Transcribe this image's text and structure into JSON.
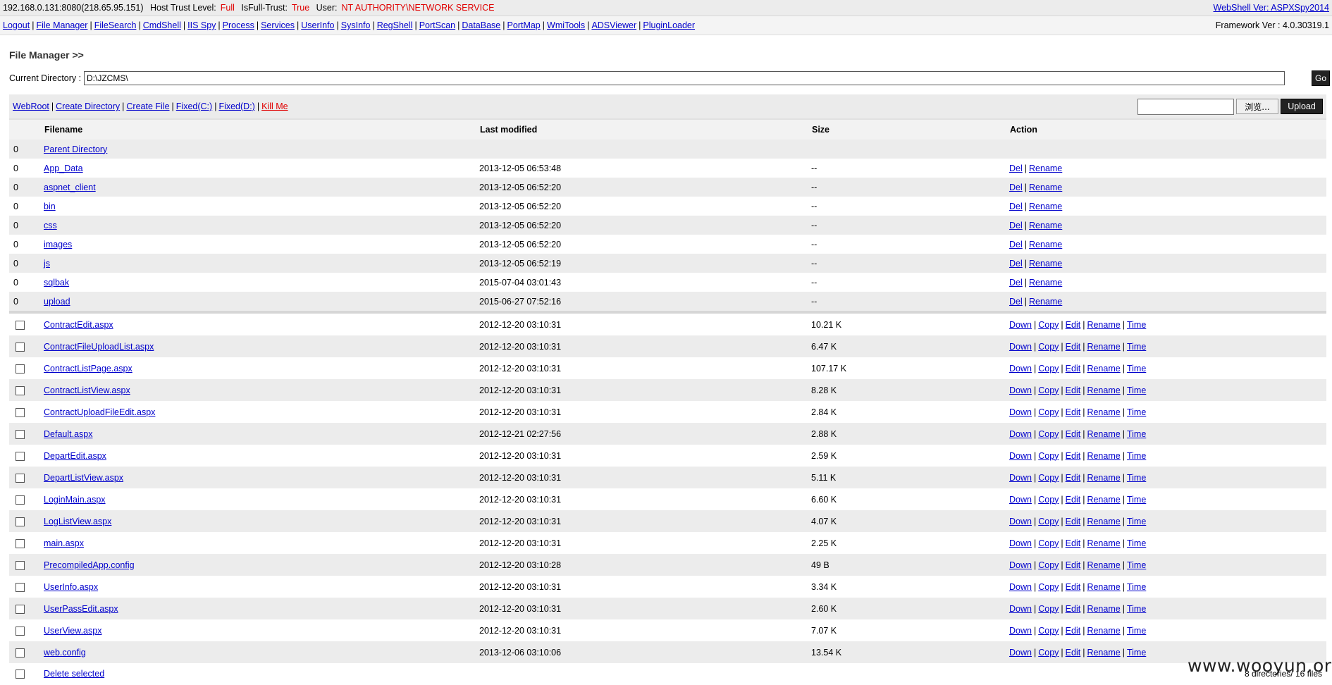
{
  "topbar": {
    "host": "192.168.0.131:8080(218.65.95.151)",
    "trust_label": "Host Trust Level:",
    "trust_value": "Full",
    "fulltrust_label": "IsFull-Trust:",
    "fulltrust_value": "True",
    "user_label": "User:",
    "user_value": "NT AUTHORITY\\NETWORK SERVICE",
    "webshell_ver": "WebShell Ver: ASPXSpy2014"
  },
  "menu": {
    "items": [
      "Logout",
      "File Manager",
      "FileSearch",
      "CmdShell",
      "IIS Spy",
      "Process",
      "Services",
      "UserInfo",
      "SysInfo",
      "RegShell",
      "PortScan",
      "DataBase",
      "PortMap",
      "WmiTools",
      "ADSViewer",
      "PluginLoader"
    ],
    "framework": "Framework Ver : 4.0.30319.1"
  },
  "page_title": "File Manager >>",
  "current_dir": {
    "label": "Current Directory :",
    "value": "D:\\JZCMS\\",
    "go": "Go"
  },
  "toolbar": {
    "webroot": "WebRoot",
    "create_dir": "Create Directory",
    "create_file": "Create File",
    "fixed_c": "Fixed(C:)",
    "fixed_d": "Fixed(D:)",
    "kill_me": "Kill Me",
    "browse": "浏览...",
    "upload": "Upload"
  },
  "table": {
    "headers": [
      "Filename",
      "Last modified",
      "Size",
      "Action"
    ],
    "parent": {
      "idx": "0",
      "name": "Parent Directory"
    },
    "dirs": [
      {
        "idx": "0",
        "name": "App_Data",
        "modified": "2013-12-05 06:53:48",
        "size": "--"
      },
      {
        "idx": "0",
        "name": "aspnet_client",
        "modified": "2013-12-05 06:52:20",
        "size": "--"
      },
      {
        "idx": "0",
        "name": "bin",
        "modified": "2013-12-05 06:52:20",
        "size": "--"
      },
      {
        "idx": "0",
        "name": "css",
        "modified": "2013-12-05 06:52:20",
        "size": "--"
      },
      {
        "idx": "0",
        "name": "images",
        "modified": "2013-12-05 06:52:20",
        "size": "--"
      },
      {
        "idx": "0",
        "name": "js",
        "modified": "2013-12-05 06:52:19",
        "size": "--"
      },
      {
        "idx": "0",
        "name": "sqlbak",
        "modified": "2015-07-04 03:01:43",
        "size": "--"
      },
      {
        "idx": "0",
        "name": "upload",
        "modified": "2015-06-27 07:52:16",
        "size": "--"
      }
    ],
    "dir_actions": [
      "Del",
      "Rename"
    ],
    "files": [
      {
        "name": "ContractEdit.aspx",
        "modified": "2012-12-20 03:10:31",
        "size": "10.21 K"
      },
      {
        "name": "ContractFileUploadList.aspx",
        "modified": "2012-12-20 03:10:31",
        "size": "6.47 K"
      },
      {
        "name": "ContractListPage.aspx",
        "modified": "2012-12-20 03:10:31",
        "size": "107.17 K"
      },
      {
        "name": "ContractListView.aspx",
        "modified": "2012-12-20 03:10:31",
        "size": "8.28 K"
      },
      {
        "name": "ContractUploadFileEdit.aspx",
        "modified": "2012-12-20 03:10:31",
        "size": "2.84 K"
      },
      {
        "name": "Default.aspx",
        "modified": "2012-12-21 02:27:56",
        "size": "2.88 K"
      },
      {
        "name": "DepartEdit.aspx",
        "modified": "2012-12-20 03:10:31",
        "size": "2.59 K"
      },
      {
        "name": "DepartListView.aspx",
        "modified": "2012-12-20 03:10:31",
        "size": "5.11 K"
      },
      {
        "name": "LoginMain.aspx",
        "modified": "2012-12-20 03:10:31",
        "size": "6.60 K"
      },
      {
        "name": "LogListView.aspx",
        "modified": "2012-12-20 03:10:31",
        "size": "4.07 K"
      },
      {
        "name": "main.aspx",
        "modified": "2012-12-20 03:10:31",
        "size": "2.25 K"
      },
      {
        "name": "PrecompiledApp.config",
        "modified": "2012-12-20 03:10:28",
        "size": "49 B"
      },
      {
        "name": "UserInfo.aspx",
        "modified": "2012-12-20 03:10:31",
        "size": "3.34 K"
      },
      {
        "name": "UserPassEdit.aspx",
        "modified": "2012-12-20 03:10:31",
        "size": "2.60 K"
      },
      {
        "name": "UserView.aspx",
        "modified": "2012-12-20 03:10:31",
        "size": "7.07 K"
      },
      {
        "name": "web.config",
        "modified": "2013-12-06 03:10:06",
        "size": "13.54 K"
      }
    ],
    "file_actions": [
      "Down",
      "Copy",
      "Edit",
      "Rename",
      "Time"
    ],
    "delete_selected": "Delete selected",
    "count": "8 directories/ 16 files"
  },
  "watermark": "www.wooyun.org"
}
